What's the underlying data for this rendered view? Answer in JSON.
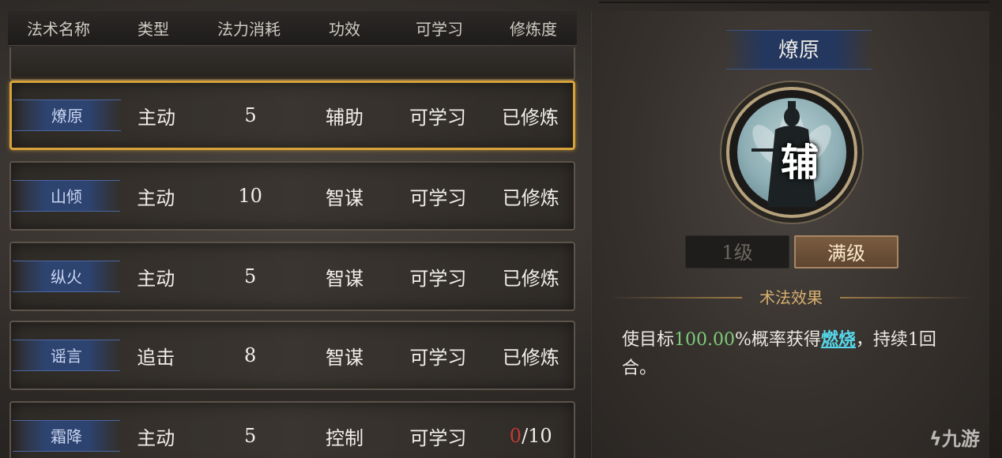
{
  "table": {
    "headers": [
      "法术名称",
      "类型",
      "法力消耗",
      "功效",
      "可学习",
      "修炼度"
    ],
    "rows": [
      {
        "name": "燎原",
        "type": "主动",
        "cost": "5",
        "effect": "辅助",
        "learnable": "可学习",
        "progress": "已修炼"
      },
      {
        "name": "山倾",
        "type": "主动",
        "cost": "10",
        "effect": "智谋",
        "learnable": "可学习",
        "progress": "已修炼"
      },
      {
        "name": "纵火",
        "type": "主动",
        "cost": "5",
        "effect": "智谋",
        "learnable": "可学习",
        "progress": "已修炼"
      },
      {
        "name": "谣言",
        "type": "追击",
        "cost": "8",
        "effect": "智谋",
        "learnable": "可学习",
        "progress": "已修炼"
      },
      {
        "name": "霜降",
        "type": "主动",
        "cost": "5",
        "effect": "控制",
        "learnable": "可学习",
        "progress_current": "0",
        "progress_total": "/10"
      }
    ]
  },
  "detail": {
    "title": "燎原",
    "icon_char": "辅",
    "level_1": "1级",
    "level_max": "满级",
    "effect_header": "术法效果",
    "effect_prefix": "使目标",
    "effect_percent": "100.00",
    "effect_mid": "%概率获得",
    "effect_link": "燃烧",
    "effect_suffix": "，持续1回合。"
  },
  "watermark": "九游",
  "colors": {
    "selected_border": "#d7a23a",
    "name_tag": "#2d4370",
    "percent_green": "#7ecb7a",
    "link_cyan": "#55d6ea",
    "progress_red": "#c23a34",
    "max_level_button": "#7a5c40"
  }
}
